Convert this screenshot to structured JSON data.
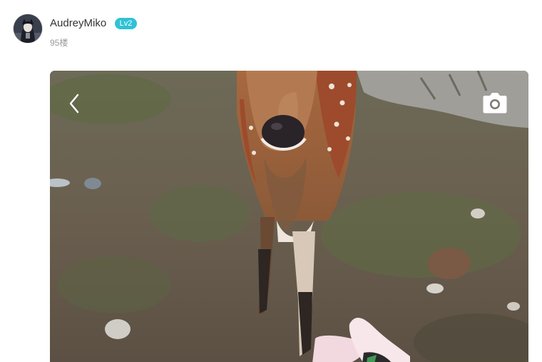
{
  "author": {
    "name": "AudreyMiko",
    "level": "Lv2",
    "floor": "95楼"
  },
  "colors": {
    "name": "#333333",
    "badge": "#2fc1d6",
    "floor": "#999999"
  },
  "photo": {
    "prev_icon": "chevron-left-icon",
    "camera_icon": "camera-icon"
  }
}
